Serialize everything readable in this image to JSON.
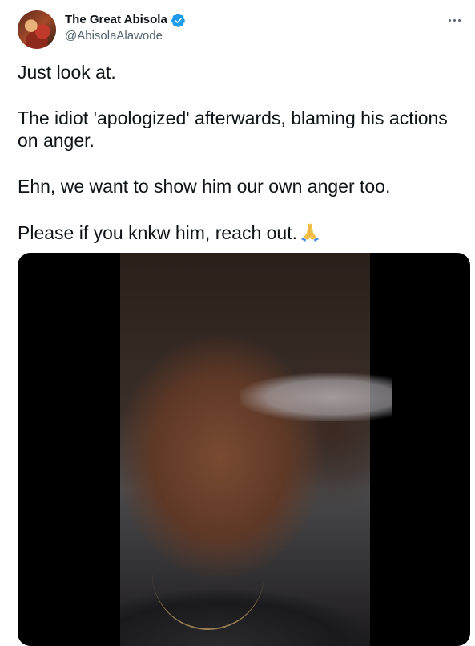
{
  "tweet": {
    "display_name": "The Great Abisola",
    "handle": "@AbisolaAlawode",
    "paragraphs": [
      "Just look at.",
      "The idiot 'apologized' afterwards, blaming his actions on anger.",
      "Ehn, we want to show him our own anger too.",
      "Please if you knkw him, reach out."
    ],
    "emoji": "folded-hands-emoji",
    "verified": true
  },
  "icons": {
    "verified": "verified-badge-icon",
    "more": "more-options-icon"
  },
  "colors": {
    "text_primary": "#0f1419",
    "text_secondary": "#536471",
    "verified_blue": "#1d9bf0"
  }
}
